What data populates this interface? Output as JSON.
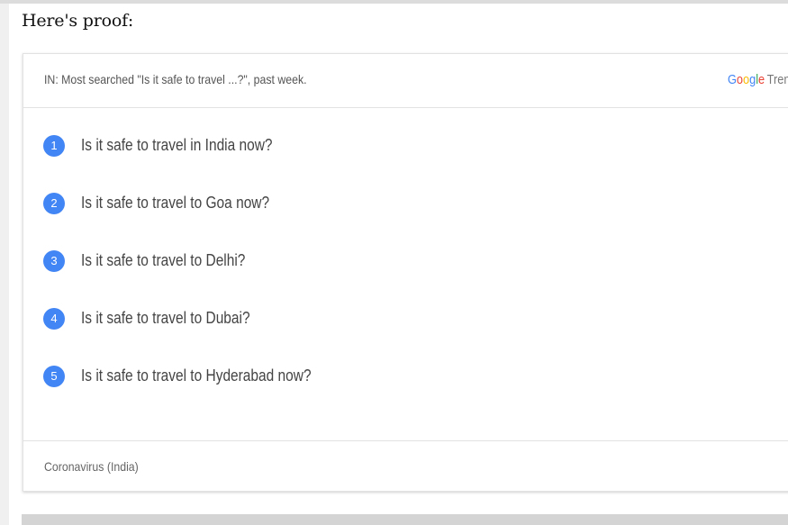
{
  "article": {
    "intro": "Here's proof:"
  },
  "widget": {
    "title": "IN: Most searched \"Is it safe to travel ...?\", past week.",
    "brand": {
      "google_letters": [
        "G",
        "o",
        "o",
        "g",
        "l",
        "e"
      ],
      "trends_fragment": "Tren"
    },
    "items": [
      {
        "rank": "1",
        "query": "Is it safe to travel in India now?"
      },
      {
        "rank": "2",
        "query": "Is it safe to travel to Goa now?"
      },
      {
        "rank": "3",
        "query": "Is it safe to travel to Delhi?"
      },
      {
        "rank": "4",
        "query": "Is it safe to travel to Dubai?"
      },
      {
        "rank": "5",
        "query": "Is it safe to travel to Hyderabad now?"
      }
    ],
    "footer": "Coronavirus (India)"
  },
  "colors": {
    "rank_badge": "#4285f4",
    "google_blue": "#4285f4",
    "google_red": "#ea4335",
    "google_yellow": "#fbbc05",
    "google_green": "#34a853"
  }
}
